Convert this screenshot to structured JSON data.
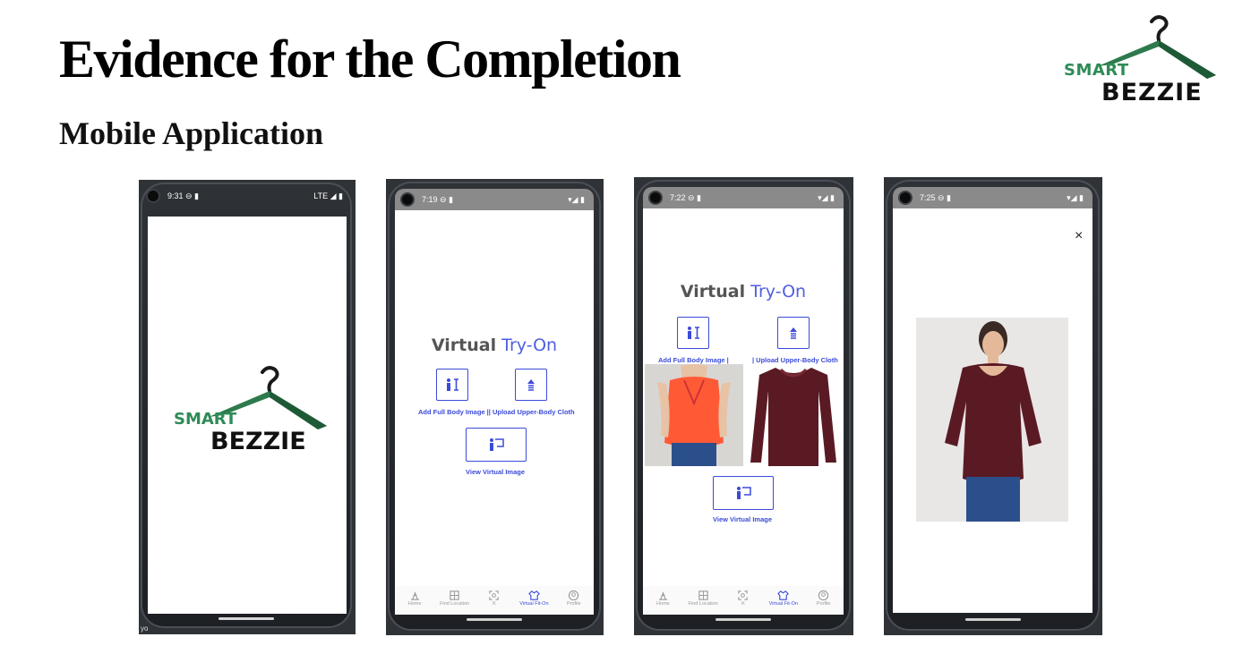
{
  "slide": {
    "title": "Evidence for the Completion",
    "subtitle": "Mobile Application"
  },
  "logo": {
    "smart": "SMART",
    "bezzie": "BEZZIE",
    "hanger_color": "#2e7a4d",
    "smart_color": "#2e8b57"
  },
  "phones": [
    {
      "status_time": "9:31 ⊖ ▮",
      "status_right": "LTE ◢ ▮",
      "footer_text": "yo"
    },
    {
      "status_time": "7:19 ⊖ ▮",
      "status_right": "▾◢ ▮",
      "title_a": "Virtual",
      "title_b": "Try-On",
      "add_body_label": "Add Full Body Image || Upload Upper-Body Cloth",
      "view_label": "View Virtual Image"
    },
    {
      "status_time": "7:22 ⊖ ▮",
      "status_right": "▾◢ ▮",
      "title_a": "Virtual",
      "title_b": "Try-On",
      "add_body_label": "Add Full Body Image |",
      "upload_cloth_label": "| Upload Upper-Body Cloth",
      "view_label": "View Virtual Image"
    },
    {
      "status_time": "7:25 ⊖ ▮",
      "status_right": "▾◢ ▮",
      "close_label": "×"
    }
  ],
  "nav": [
    {
      "label": "Home",
      "icon": "home-icon"
    },
    {
      "label": "Find Location",
      "icon": "map-icon"
    },
    {
      "label": "K",
      "icon": "scan-icon"
    },
    {
      "label": "Virtual Fit-On",
      "icon": "shirt-icon",
      "active": true
    },
    {
      "label": "Profile",
      "icon": "profile-icon"
    }
  ],
  "colors": {
    "accent": "#3b4bd8",
    "title_blue": "#4f5fe0",
    "phone_frame": "#2b2f34",
    "orange_top": "#ff5a36",
    "maroon_top": "#5a1a24"
  }
}
